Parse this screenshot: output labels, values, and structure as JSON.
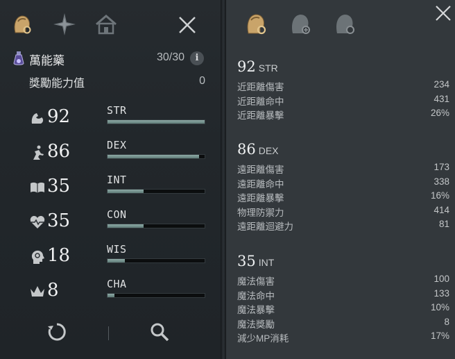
{
  "left_tabs": [
    {
      "icon": "helmet-gear-icon"
    },
    {
      "icon": "compass-star-icon"
    },
    {
      "icon": "house-icon"
    }
  ],
  "potion": {
    "name": "萬能藥",
    "count": "30/30",
    "info": "i"
  },
  "bonus": {
    "label": "獎勵能力值",
    "value": "0"
  },
  "stats": [
    {
      "abbr": "STR",
      "value": "92",
      "fill": 1.0,
      "icon": "flexed-arm-icon"
    },
    {
      "abbr": "DEX",
      "value": "86",
      "fill": 0.94,
      "icon": "running-figure-icon"
    },
    {
      "abbr": "INT",
      "value": "35",
      "fill": 0.37,
      "icon": "open-book-icon"
    },
    {
      "abbr": "CON",
      "value": "35",
      "fill": 0.37,
      "icon": "heartbeat-icon"
    },
    {
      "abbr": "WIS",
      "value": "18",
      "fill": 0.18,
      "icon": "head-profile-icon"
    },
    {
      "abbr": "CHA",
      "value": "8",
      "fill": 0.07,
      "icon": "crown-icon"
    }
  ],
  "details": [
    {
      "value": "92",
      "abbr": "STR",
      "rows": [
        {
          "label": "近距離傷害",
          "value": "234"
        },
        {
          "label": "近距離命中",
          "value": "431"
        },
        {
          "label": "近距離暴擊",
          "value": "26%"
        }
      ]
    },
    {
      "value": "86",
      "abbr": "DEX",
      "rows": [
        {
          "label": "遠距離傷害",
          "value": "173"
        },
        {
          "label": "遠距離命中",
          "value": "338"
        },
        {
          "label": "遠距離暴擊",
          "value": "16%"
        },
        {
          "label": "物理防禦力",
          "value": "414"
        },
        {
          "label": "遠距離迴避力",
          "value": "81"
        }
      ]
    },
    {
      "value": "35",
      "abbr": "INT",
      "rows": [
        {
          "label": "魔法傷害",
          "value": "100"
        },
        {
          "label": "魔法命中",
          "value": "133"
        },
        {
          "label": "魔法暴擊",
          "value": "10%"
        },
        {
          "label": "魔法獎勵",
          "value": "8"
        },
        {
          "label": "減少MP消耗",
          "value": "17%"
        }
      ]
    }
  ],
  "colors": {
    "bar_fill": "#7f9c98",
    "accent_gold": "#c9a46a"
  }
}
